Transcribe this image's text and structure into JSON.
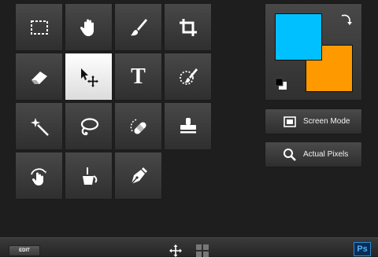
{
  "tools": [
    {
      "name": "marquee-tool",
      "icon": "dashed-rectangle-icon"
    },
    {
      "name": "hand-tool",
      "icon": "hand-icon"
    },
    {
      "name": "brush-tool",
      "icon": "brush-icon"
    },
    {
      "name": "crop-tool",
      "icon": "crop-icon"
    },
    {
      "name": "eraser-tool",
      "icon": "eraser-icon"
    },
    {
      "name": "move-tool",
      "icon": "move-arrow-icon",
      "active": true
    },
    {
      "name": "type-tool",
      "icon": "text-t-icon",
      "label": "T"
    },
    {
      "name": "quick-selection-tool",
      "icon": "quick-selection-brush-icon"
    },
    {
      "name": "magic-wand-tool",
      "icon": "magic-wand-icon"
    },
    {
      "name": "lasso-tool",
      "icon": "lasso-icon"
    },
    {
      "name": "healing-tool",
      "icon": "bandage-icon"
    },
    {
      "name": "clone-stamp-tool",
      "icon": "stamp-icon"
    },
    {
      "name": "smudge-tool",
      "icon": "finger-icon"
    },
    {
      "name": "paint-bucket-tool",
      "icon": "bucket-icon"
    },
    {
      "name": "pen-tool",
      "icon": "pen-nib-icon"
    }
  ],
  "colors": {
    "foreground": "#00c0ff",
    "background": "#ff9900"
  },
  "buttons": {
    "screen_mode": "Screen Mode",
    "actual_pixels": "Actual Pixels"
  },
  "bottombar": {
    "edit_label": "EDIT",
    "app_badge": "Ps"
  }
}
